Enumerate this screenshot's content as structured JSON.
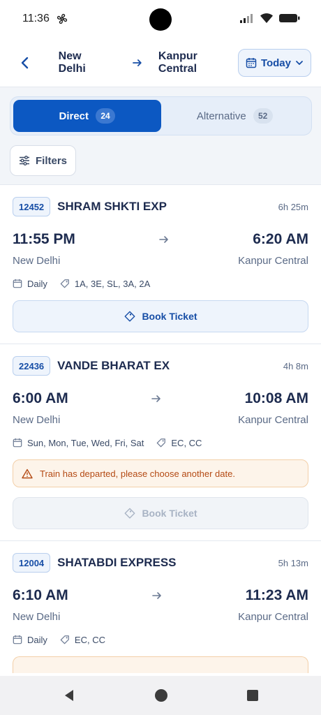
{
  "status_bar": {
    "time": "11:36"
  },
  "header": {
    "from": "New Delhi",
    "to": "Kanpur Central",
    "date": "Today"
  },
  "tabs": [
    {
      "label": "Direct",
      "count": "24"
    },
    {
      "label": "Alternative",
      "count": "52"
    }
  ],
  "filters_label": "Filters",
  "book_label": "Book Ticket",
  "trains": [
    {
      "number": "12452",
      "name": "SHRAM SHKTI EXP",
      "duration": "6h 25m",
      "departure_time": "11:55 PM",
      "arrival_time": "6:20 AM",
      "from": "New Delhi",
      "to": "Kanpur Central",
      "days": "Daily",
      "classes": "1A, 3E, SL, 3A, 2A"
    },
    {
      "number": "22436",
      "name": "VANDE BHARAT EX",
      "duration": "4h 8m",
      "departure_time": "6:00 AM",
      "arrival_time": "10:08 AM",
      "from": "New Delhi",
      "to": "Kanpur Central",
      "days": "Sun, Mon, Tue, Wed, Fri, Sat",
      "classes": "EC, CC",
      "warning": "Train has departed, please choose another date."
    },
    {
      "number": "12004",
      "name": "SHATABDI EXPRESS",
      "duration": "5h 13m",
      "departure_time": "6:10 AM",
      "arrival_time": "11:23 AM",
      "from": "New Delhi",
      "to": "Kanpur Central",
      "days": "Daily",
      "classes": "EC, CC"
    }
  ],
  "colors": {
    "primary": "#0c58c2",
    "text": "#1d2b4f",
    "warning": "#b44a14"
  }
}
